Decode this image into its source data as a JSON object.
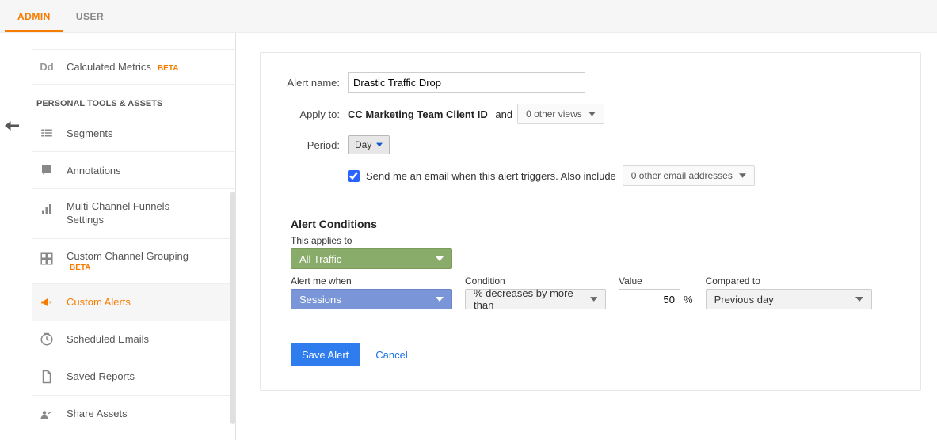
{
  "topbar": {
    "tabs": [
      "ADMIN",
      "USER"
    ],
    "active": 0
  },
  "sidebar": {
    "firstItemLabel": "Calculated Metrics",
    "betaBadge": "BETA",
    "sectionHeader": "PERSONAL TOOLS & ASSETS",
    "items": [
      {
        "label": "Segments"
      },
      {
        "label": "Annotations"
      },
      {
        "label": "Multi-Channel Funnels Settings"
      },
      {
        "label": "Custom Channel Grouping"
      },
      {
        "label": "Custom Alerts"
      },
      {
        "label": "Scheduled Emails"
      },
      {
        "label": "Saved Reports"
      },
      {
        "label": "Share Assets"
      }
    ]
  },
  "form": {
    "alertNameLabel": "Alert name:",
    "alertNameValue": "Drastic Traffic Drop",
    "applyToLabel": "Apply to:",
    "applyToView": "CC Marketing Team Client ID",
    "applyToAnd": "and",
    "applyToOther": "0 other views",
    "periodLabel": "Period:",
    "periodValue": "Day",
    "emailCheckLabel": "Send me an email when this alert triggers. Also include",
    "emailOther": "0 other email addresses"
  },
  "conditions": {
    "header": "Alert Conditions",
    "appliesToLabel": "This applies to",
    "appliesToValue": "All Traffic",
    "alertWhenLabel": "Alert me when",
    "alertWhenValue": "Sessions",
    "conditionLabel": "Condition",
    "conditionValue": "% decreases by more than",
    "valueLabel": "Value",
    "valueValue": "50",
    "pctSymbol": "%",
    "comparedToLabel": "Compared to",
    "comparedToValue": "Previous day"
  },
  "actions": {
    "save": "Save Alert",
    "cancel": "Cancel"
  }
}
